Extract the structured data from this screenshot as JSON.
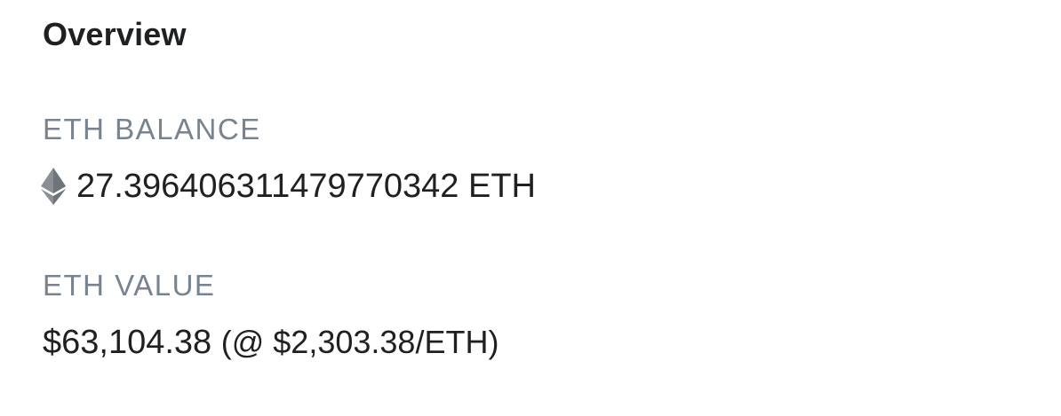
{
  "overview": {
    "title": "Overview",
    "balance_label": "ETH BALANCE",
    "balance_amount": "27.396406311479770342 ETH",
    "balance_icon": "ethereum-icon",
    "value_label": "ETH VALUE",
    "value_amount": "$63,104.38",
    "value_price": "(@ $2,303.38/ETH)"
  },
  "colors": {
    "text": "#1e2022",
    "label": "#77838f",
    "icon": "#8c8c8c"
  }
}
